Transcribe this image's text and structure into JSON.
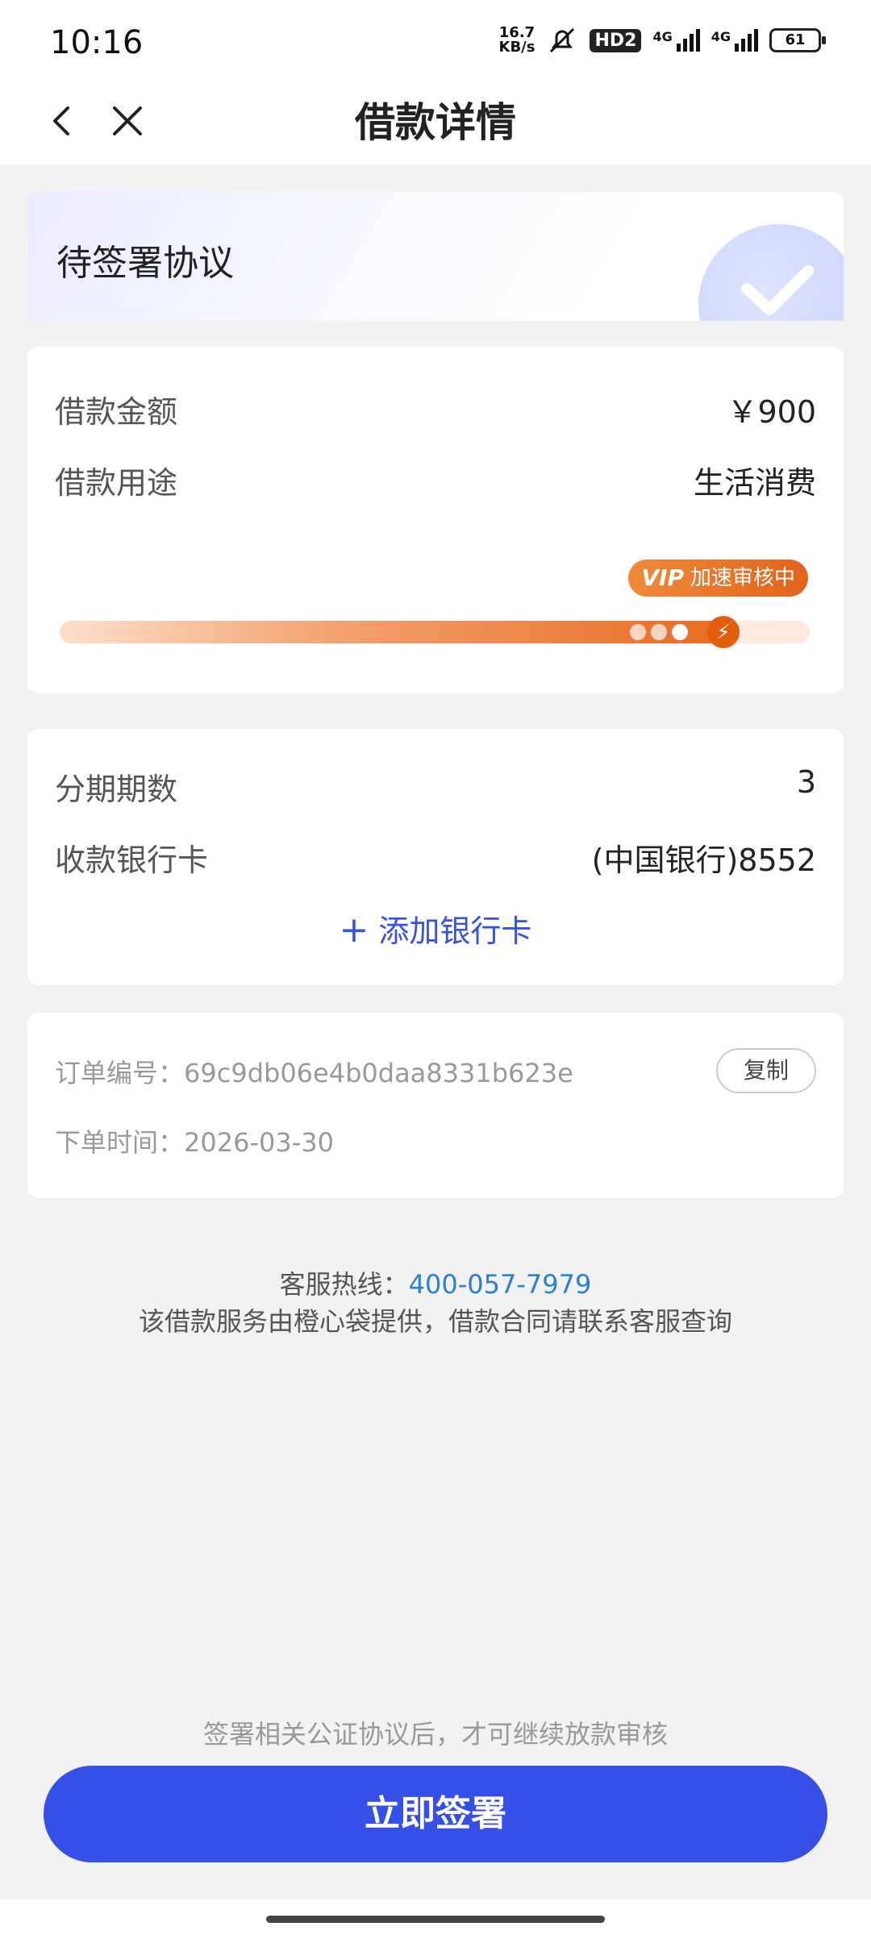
{
  "status_bar": {
    "time": "10:16",
    "net_speed_value": "16.7",
    "net_speed_unit": "KB/s",
    "hd_label": "HD2",
    "signal1_tag": "4G",
    "signal2_tag": "4G",
    "battery": "61"
  },
  "nav": {
    "title": "借款详情",
    "back_icon": "chevron-left-icon",
    "close_icon": "close-icon"
  },
  "status_card": {
    "title": "待签署协议",
    "icon": "check-icon"
  },
  "loan": {
    "amount_label": "借款金额",
    "amount_value": "￥900",
    "purpose_label": "借款用途",
    "purpose_value": "生活消费",
    "vip_logo": "VIP",
    "vip_text": "加速审核中",
    "progress_fraction": 0.9
  },
  "installment": {
    "periods_label": "分期期数",
    "periods_value": "3",
    "bank_label": "收款银行卡",
    "bank_value": "(中国银行)8552",
    "add_card_plus": "+",
    "add_card_label": "添加银行卡"
  },
  "order": {
    "number_label": "订单编号：",
    "number_value": "69c9db06e4b0daa8331b623e",
    "copy_label": "复制",
    "time_label": "下单时间：",
    "time_value": "2026-03-30"
  },
  "footer": {
    "hotline_label": "客服热线：",
    "hotline_number": "400-057-7979",
    "provider_note": "该借款服务由橙心袋提供，借款合同请联系客服查询"
  },
  "sign": {
    "hint": "签署相关公证协议后，才可继续放款审核",
    "button_label": "立即签署"
  },
  "colors": {
    "accent": "#3550e8",
    "link": "#2a7fd6",
    "vip_orange": "#e86a20",
    "page_bg": "#f2f2f2"
  }
}
